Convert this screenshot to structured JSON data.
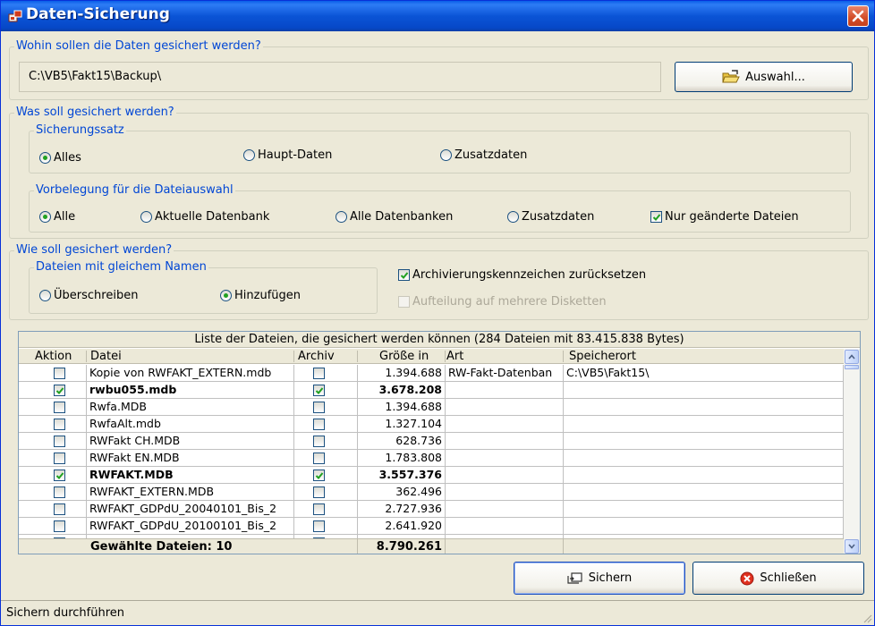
{
  "window": {
    "title": "Daten-Sicherung"
  },
  "destination": {
    "group_label": "Wohin sollen die Daten gesichert werden?",
    "path_value": "C:\\VB5\\Fakt15\\Backup\\",
    "choose_button": "Auswahl..."
  },
  "what": {
    "group_label": "Was soll gesichert werden?",
    "set": {
      "group_label": "Sicherungssatz",
      "options": [
        {
          "label": "Alles",
          "selected": true
        },
        {
          "label": "Haupt-Daten",
          "selected": false
        },
        {
          "label": "Zusatzdaten",
          "selected": false
        }
      ]
    },
    "preselect": {
      "group_label": "Vorbelegung für die Dateiauswahl",
      "options": [
        {
          "label": "Alle",
          "selected": true
        },
        {
          "label": "Aktuelle Datenbank",
          "selected": false
        },
        {
          "label": "Alle Datenbanken",
          "selected": false
        },
        {
          "label": "Zusatzdaten",
          "selected": false
        }
      ],
      "changed_only": {
        "label": "Nur geänderte Dateien",
        "checked": true
      }
    }
  },
  "how": {
    "group_label": "Wie soll gesichert werden?",
    "same_name": {
      "group_label": "Dateien mit gleichem Namen",
      "options": [
        {
          "label": "Überschreiben",
          "selected": false
        },
        {
          "label": "Hinzufügen",
          "selected": true
        }
      ]
    },
    "reset_archive": {
      "label": "Archivierungskennzeichen zurücksetzen",
      "checked": true
    },
    "split_disks": {
      "label": "Aufteilung auf mehrere Disketten",
      "checked": false,
      "enabled": false
    }
  },
  "file_list": {
    "caption": "Liste der Dateien, die gesichert werden können (284 Dateien mit 83.415.838 Bytes)",
    "columns": [
      "Aktion",
      "Datei",
      "Archiv",
      "Größe in",
      "Art",
      "Speicherort"
    ],
    "rows": [
      {
        "action": false,
        "file": "Kopie von RWFAKT_EXTERN.mdb",
        "archive": false,
        "size": "1.394.688",
        "type": "RW-Fakt-Datenban",
        "location": "C:\\VB5\\Fakt15\\",
        "bold": false
      },
      {
        "action": true,
        "file": "rwbu055.mdb",
        "archive": true,
        "size": "3.678.208",
        "type": "",
        "location": "",
        "bold": true
      },
      {
        "action": false,
        "file": "Rwfa.MDB",
        "archive": false,
        "size": "1.394.688",
        "type": "",
        "location": "",
        "bold": false
      },
      {
        "action": false,
        "file": "RwfaAlt.mdb",
        "archive": false,
        "size": "1.327.104",
        "type": "",
        "location": "",
        "bold": false
      },
      {
        "action": false,
        "file": "RWFakt CH.MDB",
        "archive": false,
        "size": "628.736",
        "type": "",
        "location": "",
        "bold": false
      },
      {
        "action": false,
        "file": "RWFakt EN.MDB",
        "archive": false,
        "size": "1.783.808",
        "type": "",
        "location": "",
        "bold": false
      },
      {
        "action": true,
        "file": "RWFAKT.MDB",
        "archive": true,
        "size": "3.557.376",
        "type": "",
        "location": "",
        "bold": true
      },
      {
        "action": false,
        "file": "RWFAKT_EXTERN.MDB",
        "archive": false,
        "size": "362.496",
        "type": "",
        "location": "",
        "bold": false
      },
      {
        "action": false,
        "file": "RWFAKT_GDPdU_20040101_Bis_2",
        "archive": false,
        "size": "2.727.936",
        "type": "",
        "location": "",
        "bold": false
      },
      {
        "action": false,
        "file": "RWFAKT_GDPdU_20100101_Bis_2",
        "archive": false,
        "size": "2.641.920",
        "type": "",
        "location": "",
        "bold": false
      },
      {
        "action": false,
        "file": "",
        "archive": false,
        "size": "",
        "type": "",
        "location": "",
        "bold": false
      }
    ],
    "footer": {
      "label": "Gewählte Dateien: 10",
      "total": "8.790.261"
    }
  },
  "buttons": {
    "save": "Sichern",
    "close": "Schließen"
  },
  "status": "Sichern durchführen",
  "colors": {
    "group_label": "#0046d5",
    "titlebar": "#0b54d6",
    "radio_dot": "#21a121"
  }
}
